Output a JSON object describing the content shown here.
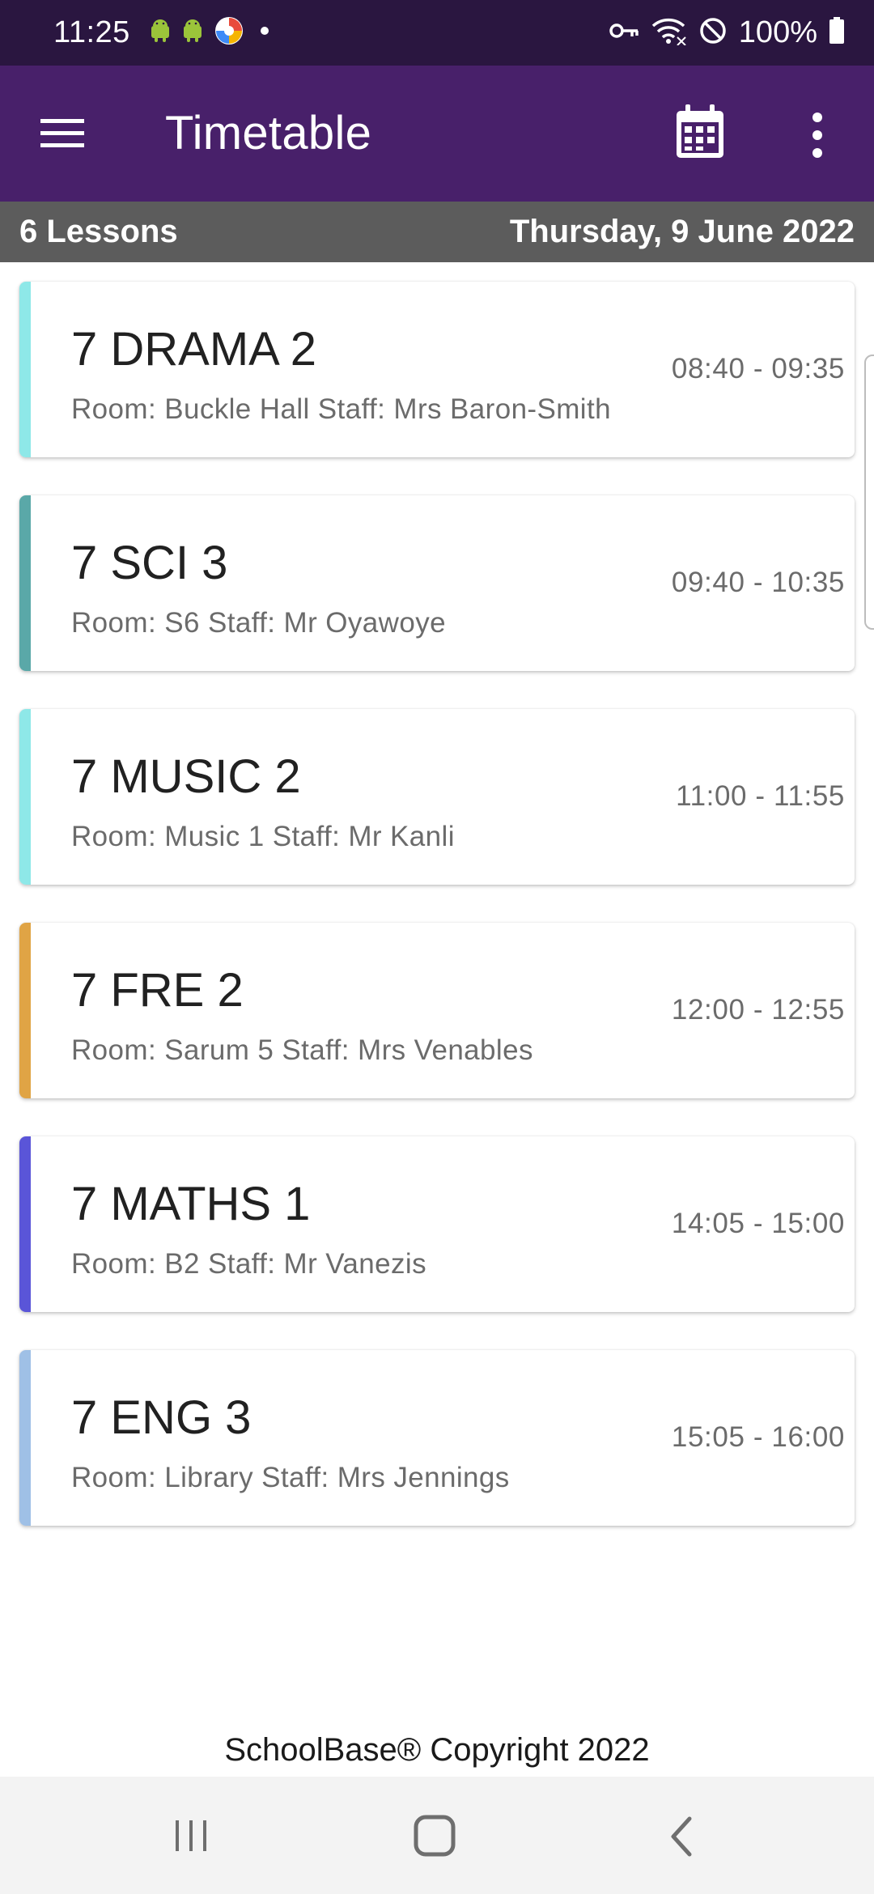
{
  "status_bar": {
    "time": "11:25",
    "battery": "100%",
    "icons": [
      "android-icon",
      "android-icon",
      "browser-icon",
      "dot-icon",
      "vpn-key-icon",
      "wifi-icon",
      "do-not-disturb-icon",
      "battery-icon"
    ]
  },
  "app_bar": {
    "title": "Timetable",
    "icons": [
      "menu-icon",
      "calendar-icon",
      "more-vert-icon"
    ],
    "background": "#48206a"
  },
  "sub_header": {
    "lesson_count": "6 Lessons",
    "date": "Thursday, 9 June 2022"
  },
  "lessons": [
    {
      "title": "7 DRAMA 2",
      "details": "Room: Buckle Hall Staff: Mrs Baron-Smith",
      "time": "08:40 - 09:35",
      "color": "#8ee8e8"
    },
    {
      "title": "7 SCI 3",
      "details": "Room: S6 Staff: Mr Oyawoye",
      "time": "09:40 - 10:35",
      "color": "#5aa8a8"
    },
    {
      "title": "7 MUSIC 2",
      "details": "Room: Music 1 Staff: Mr Kanli",
      "time": "11:00 - 11:55",
      "color": "#8ee8e8"
    },
    {
      "title": "7 FRE 2",
      "details": "Room: Sarum 5 Staff: Mrs Venables",
      "time": "12:00 - 12:55",
      "color": "#e0a445"
    },
    {
      "title": "7 MATHS 1",
      "details": "Room: B2 Staff: Mr Vanezis",
      "time": "14:05 - 15:00",
      "color": "#5a55d8"
    },
    {
      "title": "7 ENG 3",
      "details": "Room: Library Staff: Mrs Jennings",
      "time": "15:05 - 16:00",
      "color": "#9fc0e6"
    }
  ],
  "footer": {
    "copyright": "SchoolBase® Copyright 2022"
  },
  "nav_bar": {
    "icons": [
      "recents-icon",
      "home-icon",
      "back-icon"
    ]
  }
}
